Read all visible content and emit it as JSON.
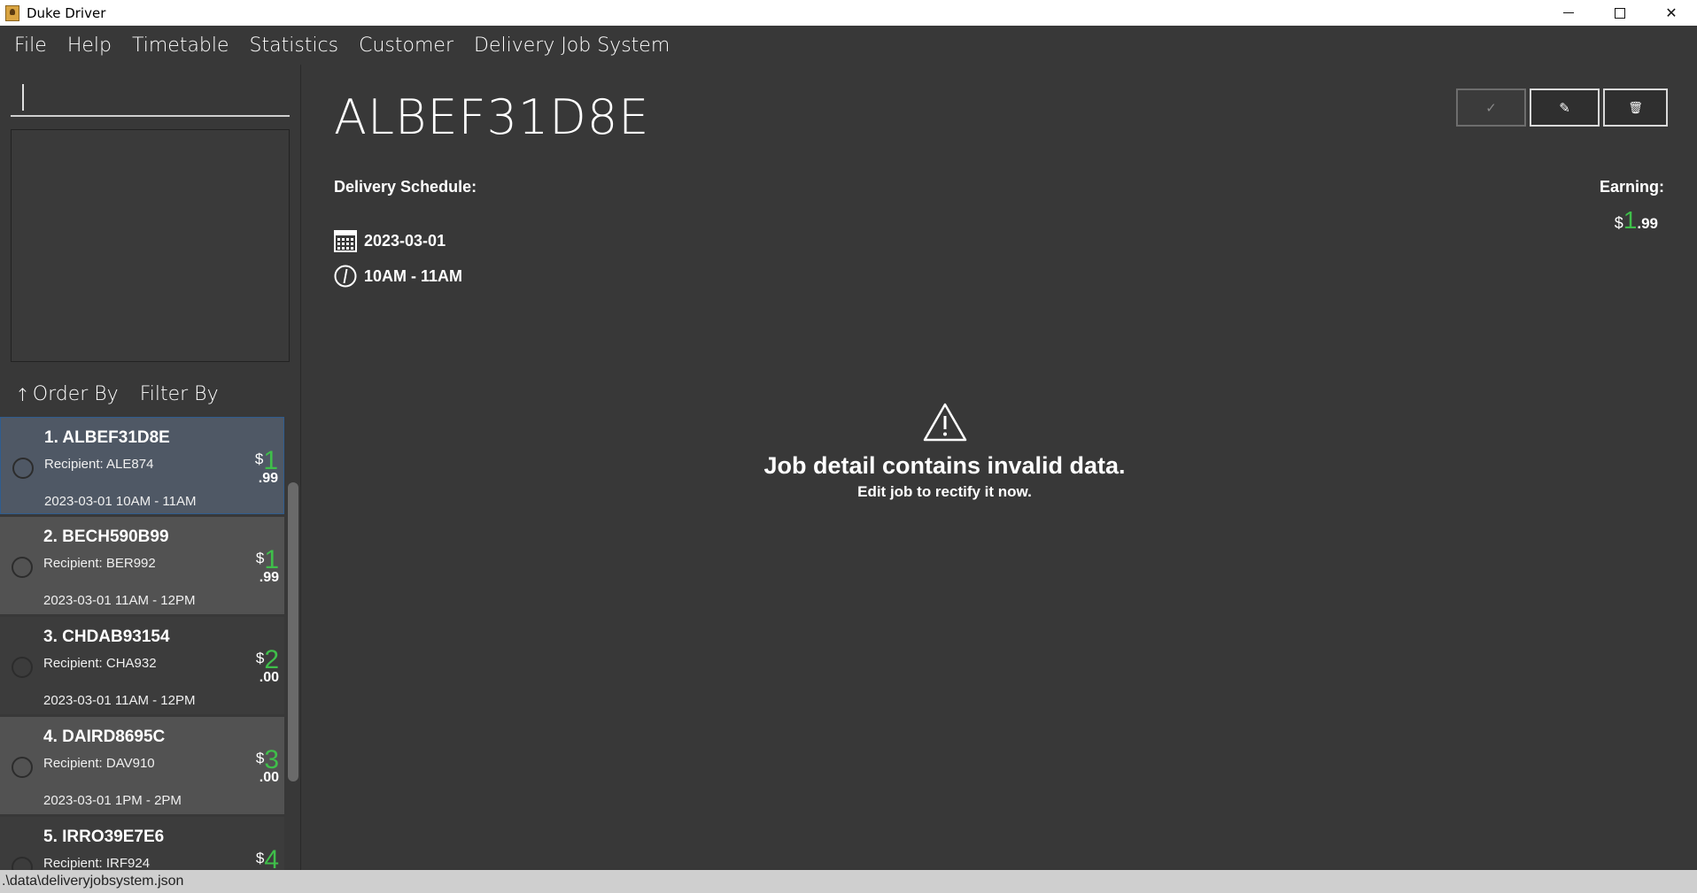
{
  "window": {
    "title": "Duke Driver",
    "minimize": "—",
    "maximize": "☐",
    "close": "✕"
  },
  "menu": [
    "File",
    "Help",
    "Timetable",
    "Statistics",
    "Customer",
    "Delivery Job System"
  ],
  "search": {
    "value": "",
    "placeholder": ""
  },
  "sort": {
    "arrow": "↑",
    "order_label": "Order By",
    "filter_label": "Filter By"
  },
  "jobs": [
    {
      "title": "1.  ALBEF31D8E",
      "recipient": "Recipient: ALE874",
      "schedule": "2023-03-01 10AM - 11AM",
      "dollar": "$",
      "int": "1",
      "dec": ".99"
    },
    {
      "title": "2.  BECH590B99",
      "recipient": "Recipient: BER992",
      "schedule": "2023-03-01 11AM - 12PM",
      "dollar": "$",
      "int": "1",
      "dec": ".99"
    },
    {
      "title": "3.  CHDAB93154",
      "recipient": "Recipient: CHA932",
      "schedule": "2023-03-01 11AM - 12PM",
      "dollar": "$",
      "int": "2",
      "dec": ".00"
    },
    {
      "title": "4.  DAIRD8695C",
      "recipient": "Recipient: DAV910",
      "schedule": "2023-03-01 1PM  - 2PM",
      "dollar": "$",
      "int": "3",
      "dec": ".00"
    },
    {
      "title": "5.  IRRO39E7E6",
      "recipient": "Recipient: IRF924",
      "schedule": "",
      "dollar": "$",
      "int": "4",
      "dec": ""
    }
  ],
  "detail": {
    "job_id": "ALBEF31D8E",
    "schedule_label": "Delivery Schedule:",
    "date": "2023-03-01",
    "time": "10AM - 11AM",
    "earning_label": "Earning:",
    "earning_dollar": "$",
    "earning_int": "1",
    "earning_dec": ".99",
    "warning_title": "Job detail contains invalid data.",
    "warning_sub": "Edit job to rectify it now.",
    "complete_icon": "✓",
    "edit_icon": "✎",
    "delete_icon": "🗑"
  },
  "status_bar": {
    "path": ".\\data\\deliveryjobsystem.json"
  },
  "colors": {
    "accent_green": "#3fbf4a",
    "background": "#383838",
    "selected": "#4f5865"
  }
}
